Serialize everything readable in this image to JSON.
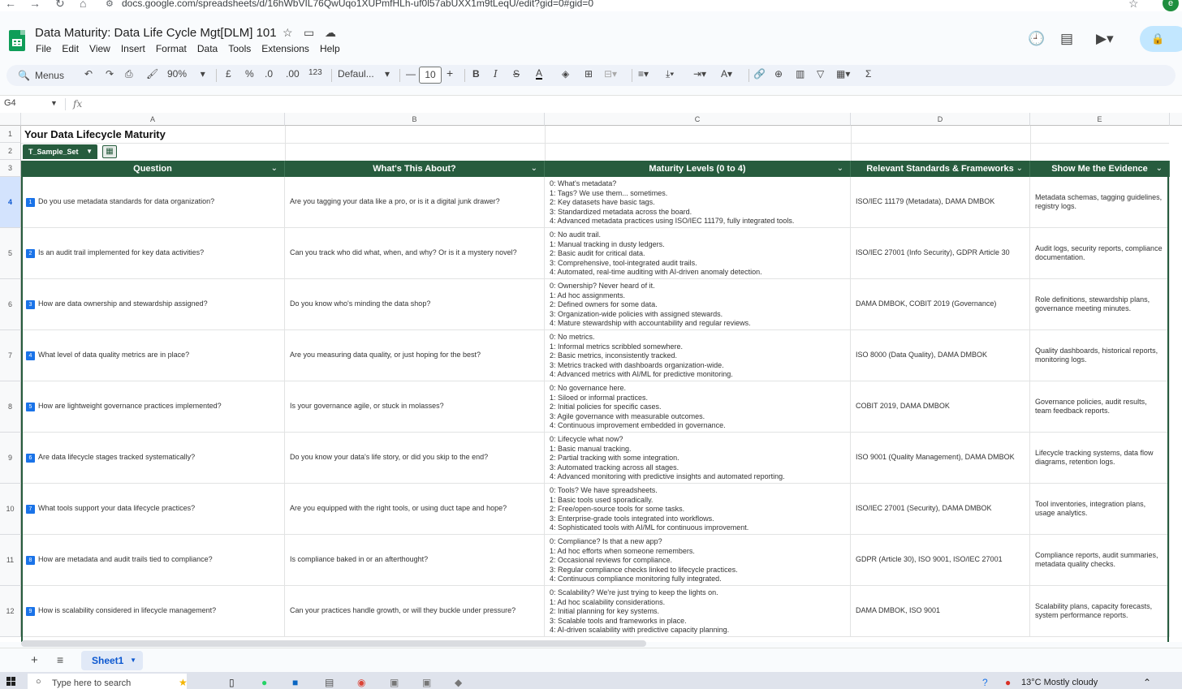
{
  "browser": {
    "url": "docs.google.com/spreadsheets/d/16hWbVIL76QwUqo1XUPmfHLh-uf0l57abUXX1m9tLeqU/edit?gid=0#gid=0"
  },
  "doc": {
    "title": "Data Maturity: Data Life Cycle Mgt[DLM] 101"
  },
  "menu": [
    "File",
    "Edit",
    "View",
    "Insert",
    "Format",
    "Data",
    "Tools",
    "Extensions",
    "Help"
  ],
  "toolbar": {
    "search_label": "Menus",
    "zoom": "90%",
    "currency": "£",
    "percent": "%",
    "decrease_decimal": ".0",
    "increase_decimal": ".00",
    "number_format": "123",
    "font": "Defaul...",
    "font_size": "10",
    "bold": "B",
    "italic": "I",
    "strike": "S",
    "text_color": "A",
    "sum": "Σ"
  },
  "namebox": "G4",
  "fx": "fx",
  "columns": [
    "A",
    "B",
    "C",
    "D",
    "E"
  ],
  "row_numbers": [
    "1",
    "2",
    "3",
    "4",
    "5",
    "6",
    "7",
    "8",
    "9",
    "10",
    "11",
    "12"
  ],
  "sheet": {
    "title": "Your Data Lifecycle Maturity",
    "table_name": "T_Sample_Set",
    "headers": [
      "Question",
      "What's This About?",
      "Maturity Levels (0 to 4)",
      "Relevant Standards & Frameworks",
      "Show Me the Evidence"
    ],
    "rows": [
      {
        "num": "1",
        "question": "Do you use metadata standards for data organization?",
        "about": "Are you tagging your data like a pro, or is it a digital junk drawer?",
        "levels": [
          "0: What's metadata?",
          "1: Tags? We use them... sometimes.",
          "2: Key datasets have basic tags.",
          "3: Standardized metadata across the board.",
          "4: Advanced metadata practices using ISO/IEC 11179, fully integrated tools."
        ],
        "standards": "ISO/IEC 11179 (Metadata), DAMA DMBOK",
        "evidence": "Metadata schemas, tagging guidelines, registry logs."
      },
      {
        "num": "2",
        "question": "Is an audit trail implemented for key data activities?",
        "about": "Can you track who did what, when, and why? Or is it a mystery novel?",
        "levels": [
          "0: No audit trail.",
          "1: Manual tracking in dusty ledgers.",
          "2: Basic audit for critical data.",
          "3: Comprehensive, tool-integrated audit trails.",
          "4: Automated, real-time auditing with AI-driven anomaly detection."
        ],
        "standards": "ISO/IEC 27001 (Info Security), GDPR Article 30",
        "evidence": "Audit logs, security reports, compliance documentation."
      },
      {
        "num": "3",
        "question": "How are data ownership and stewardship assigned?",
        "about": "Do you know who's minding the data shop?",
        "levels": [
          "0: Ownership? Never heard of it.",
          "1: Ad hoc assignments.",
          "2: Defined owners for some data.",
          "3: Organization-wide policies with assigned stewards.",
          "4: Mature stewardship with accountability and regular reviews."
        ],
        "standards": "DAMA DMBOK, COBIT 2019 (Governance)",
        "evidence": "Role definitions, stewardship plans, governance meeting minutes."
      },
      {
        "num": "4",
        "question": "What level of data quality metrics are in place?",
        "about": "Are you measuring data quality, or just hoping for the best?",
        "levels": [
          "0: No metrics.",
          "1: Informal metrics scribbled somewhere.",
          "2: Basic metrics, inconsistently tracked.",
          "3: Metrics tracked with dashboards organization-wide.",
          "4: Advanced metrics with AI/ML for predictive monitoring."
        ],
        "standards": "ISO 8000 (Data Quality), DAMA DMBOK",
        "evidence": "Quality dashboards, historical reports, monitoring logs."
      },
      {
        "num": "5",
        "question": "How are lightweight governance practices implemented?",
        "about": "Is your governance agile, or stuck in molasses?",
        "levels": [
          "0: No governance here.",
          "1: Siloed or informal practices.",
          "2: Initial policies for specific cases.",
          "3: Agile governance with measurable outcomes.",
          "4: Continuous improvement embedded in governance."
        ],
        "standards": "COBIT 2019, DAMA DMBOK",
        "evidence": "Governance policies, audit results, team feedback reports."
      },
      {
        "num": "6",
        "question": "Are data lifecycle stages tracked systematically?",
        "about": "Do you know your data's life story, or did you skip to the end?",
        "levels": [
          "0: Lifecycle what now?",
          "1: Basic manual tracking.",
          "2: Partial tracking with some integration.",
          "3: Automated tracking across all stages.",
          "4: Advanced monitoring with predictive insights and automated reporting."
        ],
        "standards": "ISO 9001 (Quality Management), DAMA DMBOK",
        "evidence": "Lifecycle tracking systems, data flow diagrams, retention logs."
      },
      {
        "num": "7",
        "question": "What tools support your data lifecycle practices?",
        "about": "Are you equipped with the right tools, or using duct tape and hope?",
        "levels": [
          "0: Tools? We have spreadsheets.",
          "1: Basic tools used sporadically.",
          "2: Free/open-source tools for some tasks.",
          "3: Enterprise-grade tools integrated into workflows.",
          "4: Sophisticated tools with AI/ML for continuous improvement."
        ],
        "standards": "ISO/IEC 27001 (Security), DAMA DMBOK",
        "evidence": "Tool inventories, integration plans, usage analytics."
      },
      {
        "num": "8",
        "question": "How are metadata and audit trails tied to compliance?",
        "about": "Is compliance baked in or an afterthought?",
        "levels": [
          "0: Compliance? Is that a new app?",
          "1: Ad hoc efforts when someone remembers.",
          "2: Occasional reviews for compliance.",
          "3: Regular compliance checks linked to lifecycle practices.",
          "4: Continuous compliance monitoring fully integrated."
        ],
        "standards": "GDPR (Article 30), ISO 9001, ISO/IEC 27001",
        "evidence": "Compliance reports, audit summaries, metadata quality checks."
      },
      {
        "num": "9",
        "question": "How is scalability considered in lifecycle management?",
        "about": "Can your practices handle growth, or will they buckle under pressure?",
        "levels": [
          "0: Scalability? We're just trying to keep the lights on.",
          "1: Ad hoc scalability considerations.",
          "2: Initial planning for key systems.",
          "3: Scalable tools and frameworks in place.",
          "4: AI-driven scalability with predictive capacity planning."
        ],
        "standards": "DAMA DMBOK, ISO 9001",
        "evidence": "Scalability plans, capacity forecasts, system performance reports."
      }
    ]
  },
  "tabs": {
    "sheet_name": "Sheet1"
  },
  "taskbar": {
    "search_placeholder": "Type here to search",
    "weather": "13°C  Mostly cloudy"
  },
  "colors": {
    "table_header": "#275c3e",
    "accent": "#0b57d0",
    "number_badge": "#1a73e8"
  }
}
